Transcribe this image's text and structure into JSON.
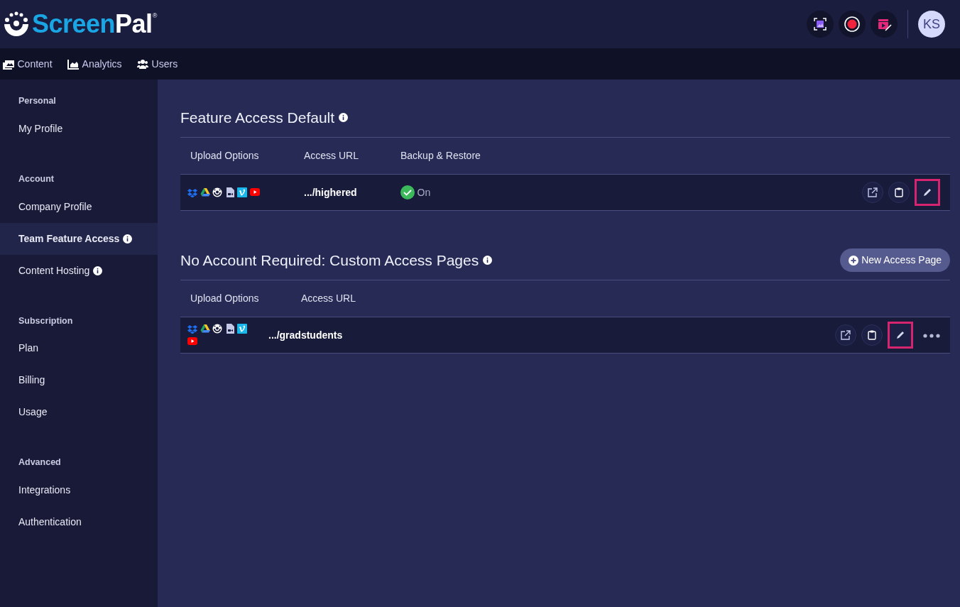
{
  "logo": {
    "part1": "Screen",
    "part2": "Pal",
    "mark": "®"
  },
  "header_tools": [
    {
      "kind": "screenshot"
    },
    {
      "kind": "record"
    },
    {
      "kind": "editor"
    }
  ],
  "avatar": {
    "initials": "KS"
  },
  "nav": [
    {
      "label": "Content",
      "kind": "content"
    },
    {
      "label": "Analytics",
      "kind": "analytics"
    },
    {
      "label": "Users",
      "kind": "users"
    }
  ],
  "sidebar": [
    {
      "heading": "Personal",
      "items": [
        {
          "label": "My Profile",
          "selected": false,
          "info": false
        }
      ]
    },
    {
      "heading": "Account",
      "items": [
        {
          "label": "Company Profile",
          "selected": false,
          "info": false
        },
        {
          "label": "Team Feature Access",
          "selected": true,
          "info": true
        },
        {
          "label": "Content Hosting",
          "selected": false,
          "info": true
        }
      ]
    },
    {
      "heading": "Subscription",
      "items": [
        {
          "label": "Plan",
          "selected": false,
          "info": false
        },
        {
          "label": "Billing",
          "selected": false,
          "info": false
        },
        {
          "label": "Usage",
          "selected": false,
          "info": false
        }
      ]
    },
    {
      "heading": "Advanced",
      "items": [
        {
          "label": "Integrations",
          "selected": false,
          "info": false
        },
        {
          "label": "Authentication",
          "selected": false,
          "info": false
        }
      ]
    }
  ],
  "sections": [
    {
      "title": "Feature Access Default",
      "columns": [
        "Upload Options",
        "Access URL",
        "Backup & Restore"
      ],
      "rows": [
        {
          "upload_options": [
            {
              "kind": "dropbox"
            },
            {
              "kind": "drive"
            },
            {
              "kind": "screenpal"
            },
            {
              "kind": "file"
            },
            {
              "kind": "vimeo"
            },
            {
              "kind": "youtube"
            }
          ],
          "url": ".../highered",
          "backup": {
            "on": true,
            "label": "On"
          },
          "edit_highlighted": true,
          "more": false
        }
      ]
    },
    {
      "title": "No Account Required: Custom Access Pages",
      "button": "New Access Page",
      "columns": [
        "Upload Options",
        "Access URL"
      ],
      "rows": [
        {
          "upload_options": [
            {
              "kind": "dropbox"
            },
            {
              "kind": "drive"
            },
            {
              "kind": "screenpal"
            },
            {
              "kind": "file"
            },
            {
              "kind": "vimeo"
            },
            {
              "kind": "youtube"
            }
          ],
          "url": ".../gradstudents",
          "backup": null,
          "edit_highlighted": true,
          "more": true
        }
      ]
    }
  ]
}
